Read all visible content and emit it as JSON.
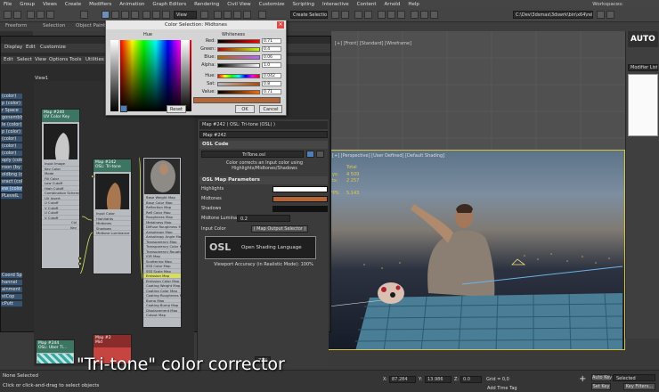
{
  "menubar": {
    "items": [
      "File",
      "Group",
      "Views",
      "Create",
      "Modifiers",
      "Animation",
      "Graph Editors",
      "Rendering",
      "Civil View",
      "Customize",
      "Scripting",
      "Interactive",
      "Content",
      "Arnold",
      "Help"
    ],
    "workspace": "Workspaces:"
  },
  "toolbar": {
    "view_select": "View",
    "named_selection": "Create Selection Se",
    "project_path": "C:\\Dev\\3dsmax\\3dswrk\\bin\\x64\\release"
  },
  "ribbon": {
    "tabs": [
      "Freeform",
      "Selection",
      "Object Paint"
    ]
  },
  "left_list": [
    "(color)",
    "p (color)",
    "r Space",
    "gonembly",
    "le (color)",
    "p (color)",
    "(color)",
    "(color)",
    "(color)",
    "oply (color)",
    "roon (by Se)",
    "oldbng (color)",
    "sract (color)",
    "ew (color)",
    "PLevelL"
  ],
  "left_list_bottom": [
    "Coord Sp",
    "hannel",
    "ainment",
    "stCop",
    "cPutt"
  ],
  "slate": {
    "menu": [
      "Edit",
      "Select",
      "View",
      "Options",
      "Tools",
      "Utilities"
    ],
    "tabs": [
      "Display",
      "Edit",
      "Customize"
    ],
    "view": "View1",
    "node1": {
      "title": "Map #240",
      "subtitle": "UV Color Key",
      "rows": [
        "Input Image",
        "Key Color",
        "Mode",
        "Fill Color",
        "Low Cutoff",
        "High Cutoff",
        "Combination Scheme",
        "UV Invert",
        "U Cutoff",
        "V Cutoff",
        "U Cutoff",
        "V Cutoff"
      ],
      "out_rows": [
        "Col",
        "Key"
      ]
    },
    "node2": {
      "title": "Map #242",
      "subtitle": "OSL: Tri-tone",
      "rows": [
        "Input Color",
        "Highlights",
        "Midtones",
        "Shadows",
        "Midtone Luminance"
      ]
    },
    "node3": {
      "rows": [
        "Base Weight Map",
        "Base Color Map",
        "Reflection Map",
        "Refl Color Map",
        "Roughness Map",
        "Metalness Map",
        "Diffuse Roughness Map",
        "Anisotropy Map",
        "Anisotropy Angle Map",
        "Transparency Map",
        "Transparency Color Map",
        "Transparency Roughness Map",
        "IOR Map",
        "Scattering Map",
        "SSS Color Map",
        "SSS Scale Map",
        "Emission Map",
        "Emission Color Map",
        "Coating Weight Map",
        "Coating Color Map",
        "Coating Roughness Map",
        "Bump Map",
        "Coating Bump Map",
        "Displacement Map",
        "Cutout Map"
      ]
    },
    "node4": {
      "title": "Map #244",
      "subtitle": "OSL: Uber Ti..."
    },
    "node5": {
      "title": "Map #2",
      "subtitle": "Mid"
    }
  },
  "params": {
    "header": "Map #242  ( OSL: Tri-tone (OSL) )",
    "map_name": "Map #242",
    "osl_code_title": "OSL Code",
    "file": "TriTone.osl",
    "description": "Color corrects an Input color using Highlights/Midtones/Shadows",
    "map_params_title": "OSL Map Parameters",
    "labels": {
      "highlights": "Highlights",
      "midtones": "Midtones",
      "shadows": "Shadows",
      "midtone_luminance": "Midtone Luminance",
      "input_color": "Input Color"
    },
    "midtone_luminance_value": "0.2",
    "input_color_map": "( Map Output Selector )",
    "logo_text": "Open Shading Language",
    "viewport_accuracy": "Viewport Accuracy (in Realistic Mode): 100%",
    "zoom": "77%",
    "colors": {
      "highlights": "#ffffff",
      "midtones": "#b5653a",
      "shadows": "#111111"
    }
  },
  "color_dialog": {
    "title": "Color Selection: Midtones",
    "hue_label": "Hue",
    "whiteness_label": "Whiteness",
    "sliders": [
      {
        "label": "Red:",
        "value": "0.71"
      },
      {
        "label": "Green:",
        "value": "0.4"
      },
      {
        "label": "Blue:",
        "value": "0.06"
      },
      {
        "label": "Alpha:",
        "value": "1.0"
      },
      {
        "label": "Hue:",
        "value": "0.042"
      },
      {
        "label": "Sat:",
        "value": "0.8"
      },
      {
        "label": "Value:",
        "value": "0.71"
      }
    ],
    "buttons": {
      "reset": "Reset",
      "ok": "OK",
      "cancel": "Cancel"
    }
  },
  "viewports": {
    "top_label": "[+] [Front] [Standard] [Wireframe]",
    "persp_label": "[+] [Perspective] [User Defined] [Default Shading]",
    "stats": {
      "total_label": "Total",
      "polys": "4 509",
      "verts": "2 257",
      "fps_label": "FPS:",
      "fps": "5.143"
    }
  },
  "command_panel": {
    "modifier_list": "Modifier List",
    "brand": "AUTO"
  },
  "caption": "\"Tri-tone\" color corrector",
  "status": {
    "selection": "None Selected",
    "hint": "Click or click-and-drag to select objects",
    "x": "87.284",
    "y": "13.986",
    "z": "0.0",
    "grid": "Grid = 0,0",
    "add_time_tag": "Add Time Tag",
    "auto_key": "Auto Key",
    "set_key": "Set Key",
    "selected": "Selected",
    "key_filters": "Key Filters..."
  }
}
